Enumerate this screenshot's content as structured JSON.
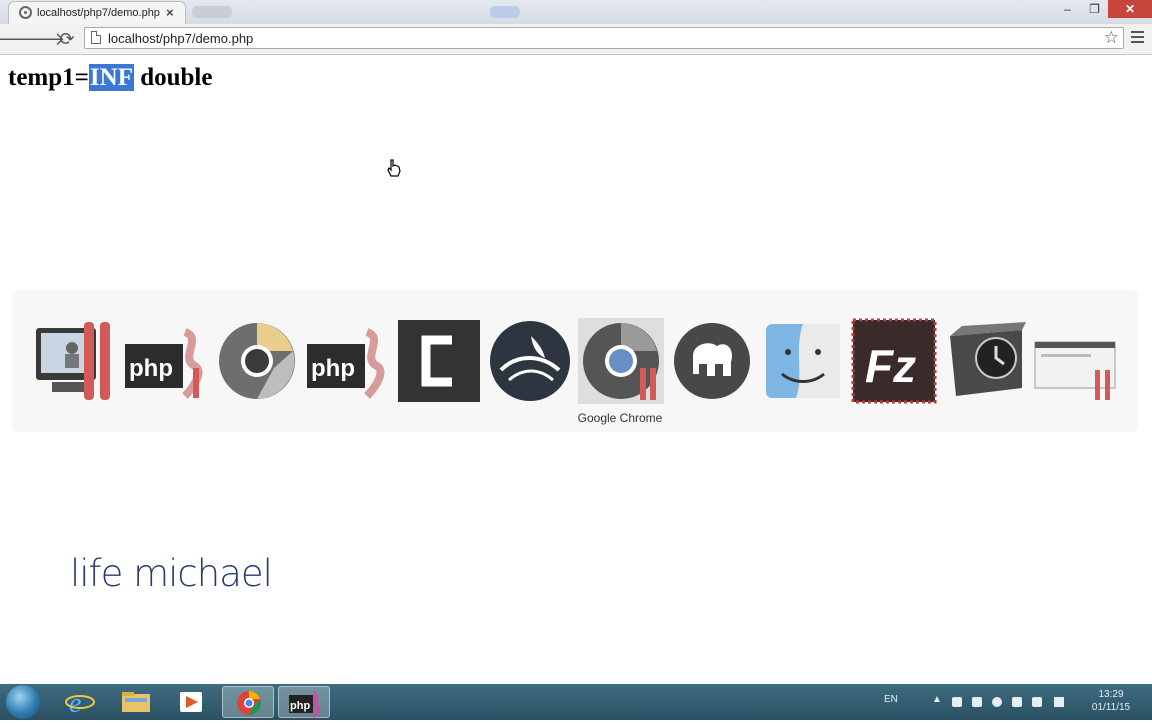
{
  "browser": {
    "tab_title": "localhost/php7/demo.php",
    "tab_close": "×",
    "url": "localhost/php7/demo.php"
  },
  "page": {
    "prefix": "temp1=",
    "selected": "INF",
    "suffix": " double"
  },
  "dock": {
    "hover_label": "Google Chrome",
    "items": [
      {
        "icon": "vm-display-icon"
      },
      {
        "icon": "phpstorm-icon"
      },
      {
        "icon": "chrome-icon"
      },
      {
        "icon": "phpstorm-icon"
      },
      {
        "icon": "camtasia-icon"
      },
      {
        "icon": "openoffice-icon"
      },
      {
        "icon": "chrome-icon"
      },
      {
        "icon": "mamp-icon"
      },
      {
        "icon": "finder-icon"
      },
      {
        "icon": "filezilla-icon"
      },
      {
        "icon": "time-machine-icon"
      },
      {
        "icon": "window-preview-icon"
      }
    ],
    "php_text": "php",
    "fz_text": "Fz"
  },
  "watermark": "life michael",
  "taskbar": {
    "lang": "EN",
    "time": "13:29",
    "date": "01/11/15"
  },
  "colors": {
    "selection": "#3a77d6",
    "taskbar": "#2f5a6c",
    "close_button": "#c8453c",
    "watermark": "#2b3b70"
  }
}
